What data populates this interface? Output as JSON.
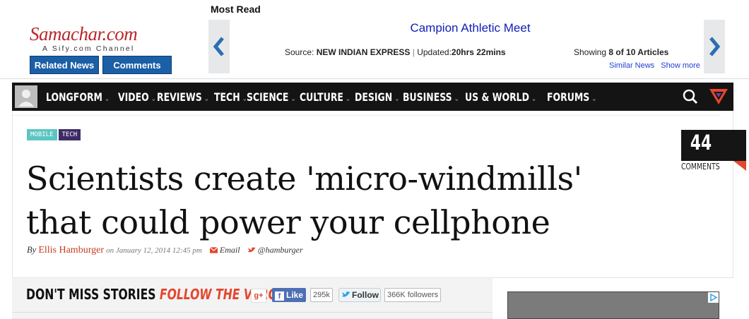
{
  "header": {
    "logo_text": "Samachar.com",
    "logo_tagline": "A Sify.com Channel",
    "related_news": "Related News",
    "comments": "Comments"
  },
  "most_read": {
    "label": "Most Read",
    "headline": "Campion Athletic Meet",
    "source_prefix": "Source:",
    "source": "NEW INDIAN EXPRESS",
    "updated_prefix": "Updated:",
    "updated": "20hrs 22mins",
    "showing_prefix": "Showing",
    "showing_count": "8 of 10 Articles",
    "similar_news": "Similar News",
    "show_more": "Show more"
  },
  "nav": {
    "items": [
      {
        "label": "LONGFORM"
      },
      {
        "label": "VIDEO"
      },
      {
        "label": "REVIEWS"
      },
      {
        "label": "TECH"
      },
      {
        "label": "SCIENCE"
      },
      {
        "label": "CULTURE"
      },
      {
        "label": "DESIGN"
      },
      {
        "label": "BUSINESS"
      },
      {
        "label": "US & WORLD"
      },
      {
        "label": "FORUMS"
      }
    ],
    "icons": [
      "user-avatar-icon",
      "search-icon",
      "verge-logo-icon"
    ]
  },
  "article": {
    "tags": [
      "MOBILE",
      "TECH"
    ],
    "title_line1": "Scientists create 'micro-windmills'",
    "title_line2": "that could power your cellphone",
    "by": "By",
    "author": "Ellis Hamburger",
    "date": "on January 12, 2014 12:45 pm",
    "email": "Email",
    "twitter": "@hamburger",
    "comment_count": "44",
    "comment_label": "COMMENTS"
  },
  "follow": {
    "dont_miss": "DON'T MISS STORIES",
    "follow_verge": "FOLLOW THE VERGE",
    "gplus": "g+",
    "like": "Like",
    "like_count": "295k",
    "follow_label": "Follow",
    "followers": "366K followers"
  },
  "colors": {
    "logo_red": "#b8272b",
    "button_blue": "#1b5fa6",
    "nav_bg": "#141414",
    "accent_orange": "#e4462e",
    "tag_mobile": "#5cc5c2",
    "tag_tech": "#3d2b66"
  }
}
